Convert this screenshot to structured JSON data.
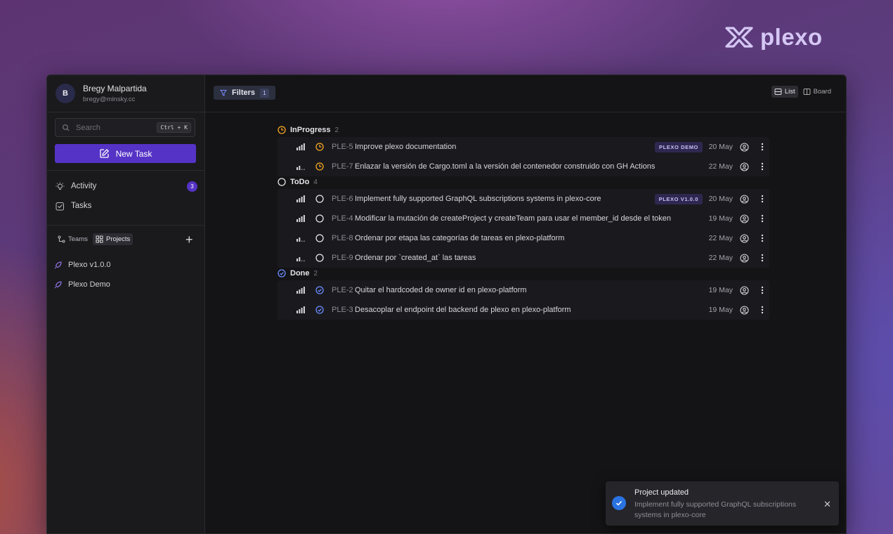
{
  "brand": {
    "name": "plexo"
  },
  "user": {
    "initial": "B",
    "name": "Bregy Malpartida",
    "email": "bregy@minsky.cc"
  },
  "search": {
    "placeholder": "Search",
    "shortcut": "Ctrl + K"
  },
  "new_task": {
    "label": "New Task"
  },
  "nav": [
    {
      "label": "Activity",
      "icon": "bulb-icon",
      "badge": "3"
    },
    {
      "label": "Tasks",
      "icon": "checkbox-icon"
    }
  ],
  "tabs": [
    {
      "label": "Teams",
      "icon": "teams-icon",
      "active": false
    },
    {
      "label": "Projects",
      "icon": "grid-icon",
      "active": true
    }
  ],
  "projects": [
    {
      "label": "Plexo v1.0.0",
      "icon": "rocket-icon"
    },
    {
      "label": "Plexo Demo",
      "icon": "rocket-icon"
    }
  ],
  "topbar": {
    "filters_label": "Filters",
    "filters_count": "1",
    "view_list": "List",
    "view_board": "Board",
    "active_view": "List"
  },
  "groups": [
    {
      "name": "InProgress",
      "count": "2",
      "status_color": "#f5a623",
      "tasks": [
        {
          "id": "PLE-5",
          "title": "Improve plexo documentation",
          "priority": "high",
          "label": "PLEXO DEMO",
          "date": "20 May"
        },
        {
          "id": "PLE-7",
          "title": "Enlazar la versión de Cargo.toml a la versión del contenedor construido con GH Actions",
          "priority": "low",
          "label": "",
          "date": "22 May"
        }
      ]
    },
    {
      "name": "ToDo",
      "count": "4",
      "status_color": "#e6e6ea",
      "tasks": [
        {
          "id": "PLE-6",
          "title": "Implement fully supported GraphQL subscriptions systems in plexo-core",
          "priority": "high",
          "label": "PLEXO V1.0.0",
          "date": "20 May"
        },
        {
          "id": "PLE-4",
          "title": "Modificar la mutación de createProject y createTeam para usar el member_id desde el token",
          "priority": "high",
          "label": "",
          "date": "19 May"
        },
        {
          "id": "PLE-8",
          "title": "Ordenar por etapa las categorías de tareas en plexo-platform",
          "priority": "low",
          "label": "",
          "date": "22 May"
        },
        {
          "id": "PLE-9",
          "title": "Ordenar por `created_at` las tareas",
          "priority": "low",
          "label": "",
          "date": "22 May"
        }
      ]
    },
    {
      "name": "Done",
      "count": "2",
      "status_color": "#6b8cff",
      "tasks": [
        {
          "id": "PLE-2",
          "title": "Quitar el hardcoded de owner id en plexo-platform",
          "priority": "high",
          "label": "",
          "date": "19 May"
        },
        {
          "id": "PLE-3",
          "title": "Desacoplar el endpoint del backend de plexo en plexo-platform",
          "priority": "high",
          "label": "",
          "date": "19 May"
        }
      ]
    }
  ],
  "toast": {
    "title": "Project updated",
    "description": "Implement fully supported GraphQL subscriptions systems in plexo-core",
    "icon": "check-circle-icon"
  }
}
